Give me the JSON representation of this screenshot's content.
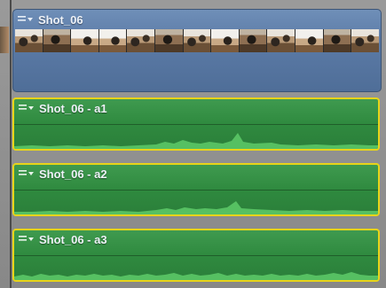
{
  "video_clip": {
    "name": "Shot_06"
  },
  "audio_clips": [
    {
      "name": "Shot_06 - a1"
    },
    {
      "name": "Shot_06 - a2"
    },
    {
      "name": "Shot_06 - a3"
    }
  ],
  "colors": {
    "video_clip": "#5b7aa6",
    "audio_clip": "#2f8a3f",
    "selection_border": "#e8d419"
  }
}
